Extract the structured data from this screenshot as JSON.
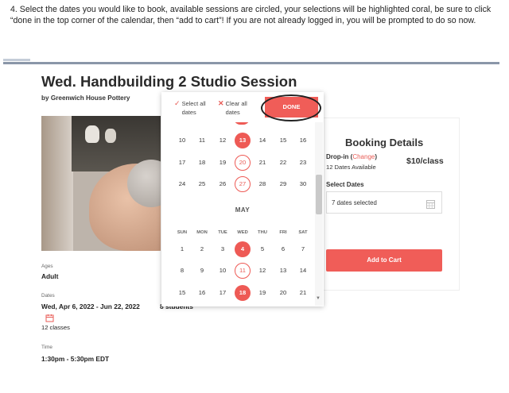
{
  "instruction": "4. Select the dates you would like to book, available sessions are circled, your selections will be highlighted coral, be sure to click “done in the top corner of the calendar, then “add to cart”! If you are not already logged in, you will be prompted to do so now.",
  "course": {
    "title": "Wed. Handbuilding 2 Studio Session",
    "byline": "by Greenwich House Pottery"
  },
  "details": {
    "ages_label": "Ages",
    "ages_value": "Adult",
    "dates_label": "Dates",
    "dates_value": "Wed, Apr 6, 2022 - Jun 22, 2022",
    "classes_count": "12 classes",
    "students": "8 students",
    "time_label": "Time",
    "time_value": "1:30pm - 5:30pm EDT"
  },
  "booking": {
    "title": "Booking Details",
    "dropin_label": "Drop-in (",
    "change_link": "Change",
    "dropin_close": ")",
    "available": "12 Dates Available",
    "price": "$10/class",
    "select_dates_label": "Select Dates",
    "selected_value": "7 dates selected",
    "add_to_cart": "Add to Cart"
  },
  "calendar": {
    "select_all": "Select all dates",
    "clear_all": "Clear all dates",
    "done": "DONE",
    "month_label": "MAY",
    "weekdays": [
      "SUN",
      "MON",
      "TUE",
      "WED",
      "THU",
      "FRI",
      "SAT"
    ],
    "april_rows": [
      [
        "10",
        "11",
        "12",
        "13",
        "14",
        "15",
        "16"
      ],
      [
        "17",
        "18",
        "19",
        "20",
        "21",
        "22",
        "23"
      ],
      [
        "24",
        "25",
        "26",
        "27",
        "28",
        "29",
        "30"
      ]
    ],
    "may_rows": [
      [
        "1",
        "2",
        "3",
        "4",
        "5",
        "6",
        "7"
      ],
      [
        "8",
        "9",
        "10",
        "11",
        "12",
        "13",
        "14"
      ],
      [
        "15",
        "16",
        "17",
        "18",
        "19",
        "20",
        "21"
      ]
    ],
    "selected_dates": [
      "13",
      "4",
      "18"
    ],
    "available_dates": [
      "20",
      "27",
      "11"
    ]
  },
  "colors": {
    "accent": "#f05d58",
    "text": "#222222"
  }
}
